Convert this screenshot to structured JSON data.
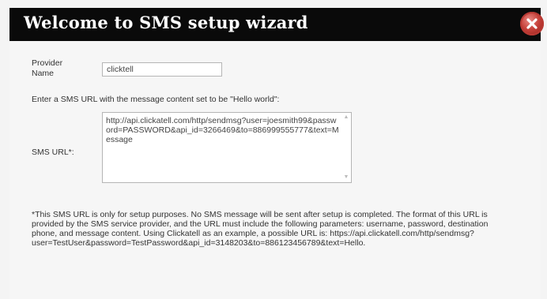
{
  "window": {
    "title": "Welcome to SMS setup wizard",
    "close_icon": "close-icon"
  },
  "form": {
    "provider_label": "Provider Name",
    "provider_value": "clicktell",
    "instruction": "Enter a SMS URL with the message content set to be \"Hello world\":",
    "sms_url_label": "SMS URL*:",
    "sms_url_value": "http://api.clickatell.com/http/sendmsg?user=joesmith99&password=PASSWORD&api_id=3266469&to=886999555777&text=Message"
  },
  "note": {
    "text": "*This SMS URL is only for setup purposes. No SMS message will be sent after setup is completed. The format of this URL is provided by the SMS service provider, and the URL must include the following parameters: username, password, destination phone, and message content. Using Clickatell as an example, a possible URL is: https://api.clickatell.com/http/sendmsg?user=TestUser&password=TestPassword&api_id=3148203&to=886123456789&text=Hello."
  },
  "colors": {
    "titlebar": "#0a0a0a",
    "title_text": "#ffffff",
    "close_button": "#c6413a",
    "background": "#f4f4f4"
  }
}
